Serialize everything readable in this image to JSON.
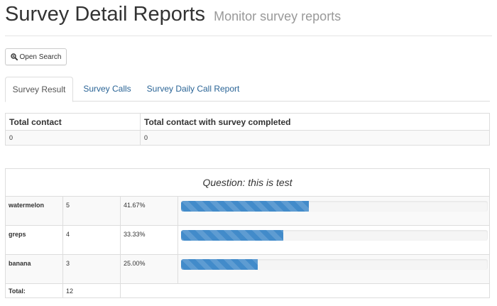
{
  "header": {
    "title": "Survey Detail Reports",
    "subtitle": "Monitor survey reports"
  },
  "toolbar": {
    "open_search_label": "Open Search",
    "open_search_icon": "zoom-in-icon"
  },
  "tabs": [
    {
      "label": "Survey Result",
      "active": true
    },
    {
      "label": "Survey Calls",
      "active": false
    },
    {
      "label": "Survey Daily Call Report",
      "active": false
    }
  ],
  "summary": {
    "headers": [
      "Total contact",
      "Total contact with survey completed"
    ],
    "values": [
      "0",
      "0"
    ]
  },
  "question": {
    "title": "Question: this is test",
    "answers": [
      {
        "label": "watermelon",
        "count": "5",
        "percent": "41.67%",
        "fraction": 0.4167
      },
      {
        "label": "greps",
        "count": "4",
        "percent": "33.33%",
        "fraction": 0.3333
      },
      {
        "label": "banana",
        "count": "3",
        "percent": "25.00%",
        "fraction": 0.25
      }
    ],
    "total_label": "Total:",
    "total_value": "12"
  },
  "colors": {
    "progress_bar": "#428bca",
    "tab_link": "#2a6496"
  }
}
